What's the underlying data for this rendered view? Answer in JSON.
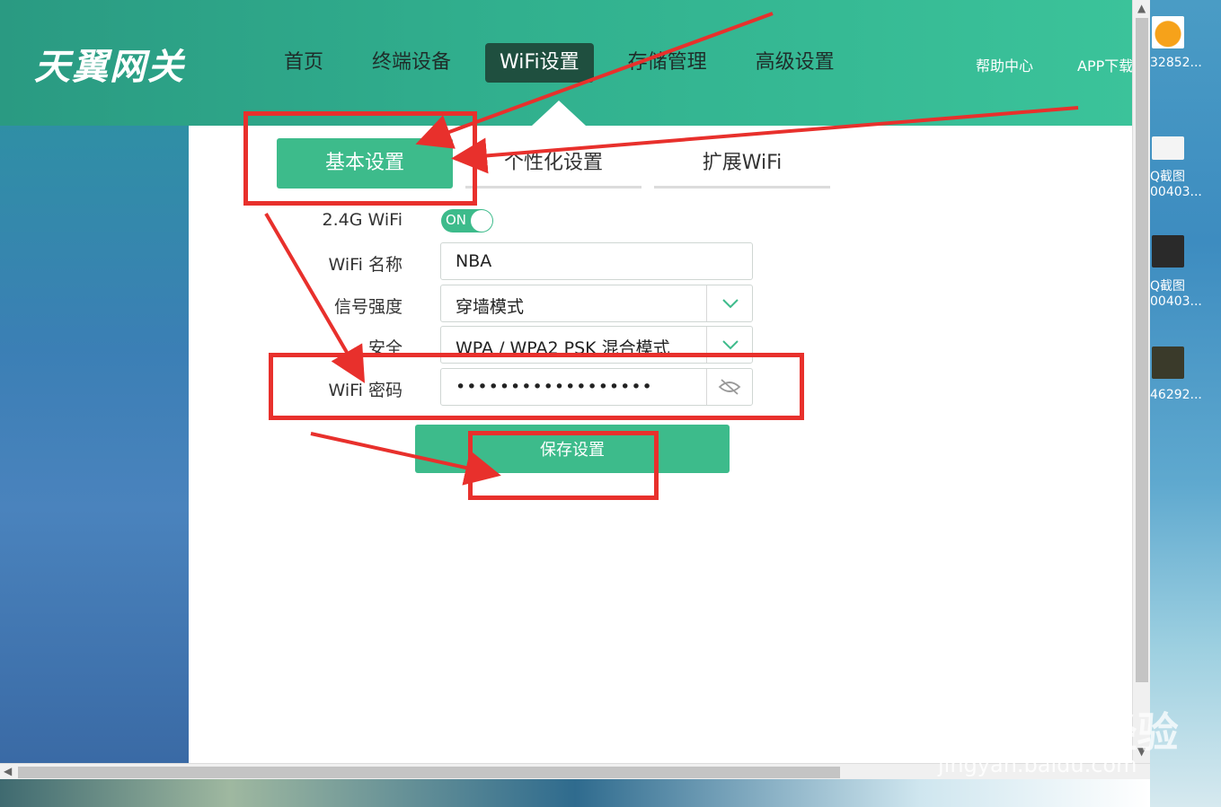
{
  "logo": "天翼网关",
  "nav": {
    "items": [
      "首页",
      "终端设备",
      "WiFi设置",
      "存储管理",
      "高级设置"
    ],
    "active_index": 2
  },
  "top_links": {
    "help": "帮助中心",
    "app": "APP下载"
  },
  "subtabs": [
    "基本设置",
    "个性化设置",
    "扩展WiFi"
  ],
  "form": {
    "wifi24_label": "2.4G WiFi",
    "toggle_text": "ON",
    "toggle_on": true,
    "name_label": "WiFi 名称",
    "name_value": "NBA",
    "signal_label": "信号强度",
    "signal_value": "穿墙模式",
    "security_label": "安全",
    "security_value": "WPA / WPA2 PSK 混合模式",
    "password_label": "WiFi 密码",
    "password_value": "••••••••••••••••••",
    "save_label": "保存设置"
  },
  "desktop_icons": [
    {
      "label": "32852..."
    },
    {
      "label": "Q截图"
    },
    {
      "label": "00403..."
    },
    {
      "label": "Q截图"
    },
    {
      "label": "00403..."
    },
    {
      "label": "46292..."
    }
  ],
  "watermark": {
    "brand": "Bai du 经验",
    "url": "jingyan.baidu.com"
  },
  "colors": {
    "accent": "#3dbb8b",
    "nav_active": "#1f4f3f",
    "annotation": "#e8302c"
  }
}
